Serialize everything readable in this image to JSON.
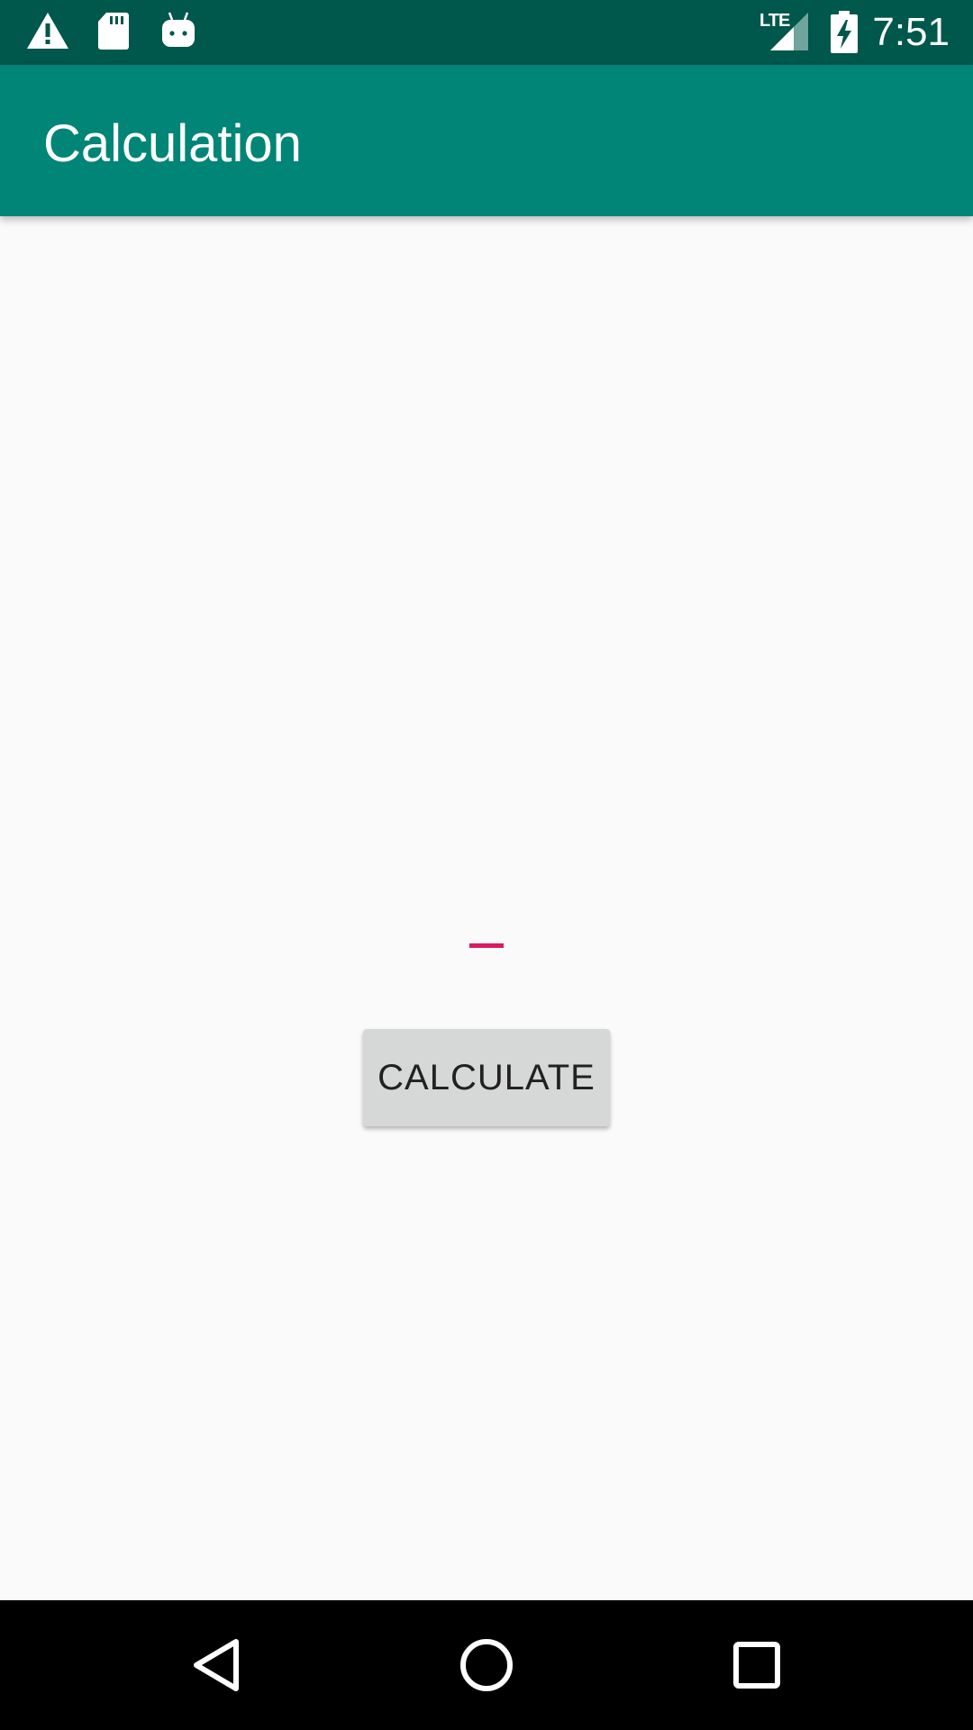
{
  "status_bar": {
    "time": "7:51",
    "network_label": "LTE",
    "icons": [
      "warning-icon",
      "sd-card-icon",
      "android-debug-icon",
      "signal-icon",
      "battery-charging-icon"
    ]
  },
  "app_bar": {
    "title": "Calculation"
  },
  "main": {
    "result_text": "",
    "calculate_button_label": "CALCULATE"
  },
  "nav_bar": {
    "buttons": [
      "back-icon",
      "home-icon",
      "recents-icon"
    ]
  },
  "colors": {
    "status_bar": "#00574b",
    "primary": "#008577",
    "accent": "#d81b60",
    "background": "#fafafa",
    "button": "#d6d7d7"
  }
}
